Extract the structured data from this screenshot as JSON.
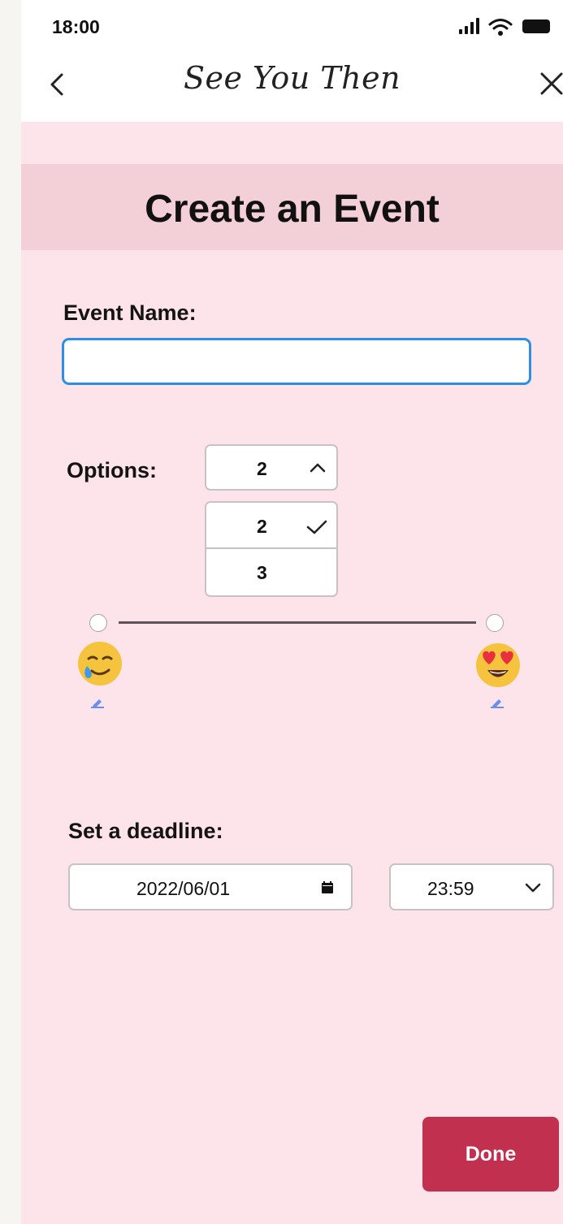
{
  "status_bar": {
    "time": "18:00"
  },
  "nav": {
    "title": "See You Then"
  },
  "page": {
    "title": "Create an Event"
  },
  "event_name": {
    "label": "Event Name:",
    "value": "",
    "placeholder": ""
  },
  "options": {
    "label": "Options:",
    "selected": "2",
    "dropdown_items": [
      "2",
      "3"
    ]
  },
  "slider": {
    "left_emoji": "smiling-face-with-tear",
    "right_emoji": "smiling-face-with-heart-eyes"
  },
  "deadline": {
    "label": "Set a deadline:",
    "date": "2022/06/01",
    "time": "23:59"
  },
  "done_label": "Done",
  "colors": {
    "background": "#fce4ea",
    "title_band": "#f3cfd8",
    "accent": "#c23050",
    "input_focus": "#2d8ee6"
  }
}
